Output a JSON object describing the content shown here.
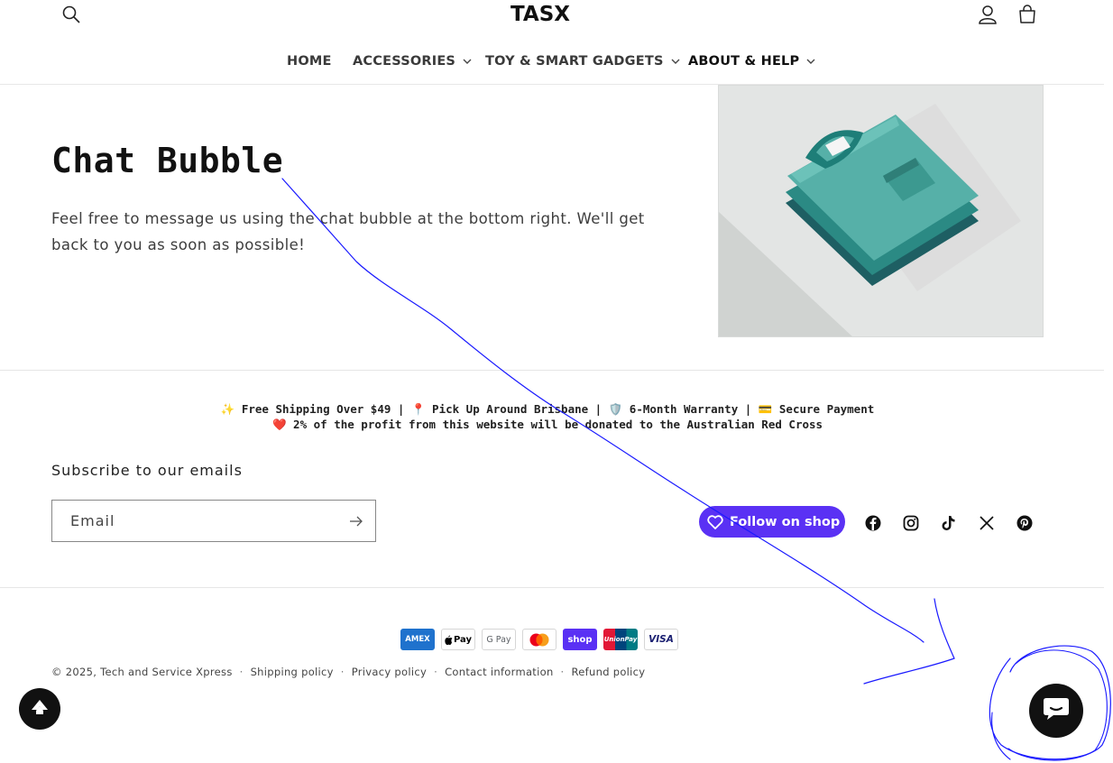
{
  "header": {
    "logo_text": "TASX",
    "search_icon": "search-icon",
    "account_icon": "account-icon",
    "cart_icon": "cart-icon"
  },
  "nav": {
    "items": [
      {
        "label": "HOME",
        "has_dropdown": false
      },
      {
        "label": "ACCESSORIES",
        "has_dropdown": true
      },
      {
        "label": "TOY & SMART GADGETS",
        "has_dropdown": true
      },
      {
        "label": "ABOUT & HELP",
        "has_dropdown": true,
        "active": true
      }
    ]
  },
  "hero": {
    "title": "Chat Bubble",
    "text": "Feel free to message us using the chat bubble at the bottom right. We'll get back to you as soon as possible!",
    "image_icon": "folded-shirts-illustration"
  },
  "announcement": {
    "line1": "✨ Free Shipping Over $49 | 📍 Pick Up Around Brisbane | 🛡️ 6-Month Warranty | 💳 Secure Payment",
    "line2": "❤️ 2% of the profit from this website will be donated to the Australian Red Cross"
  },
  "subscribe": {
    "title": "Subscribe to our emails",
    "email_placeholder": "Email"
  },
  "follow": {
    "label": "Follow on shop"
  },
  "social": [
    "facebook-icon",
    "instagram-icon",
    "tiktok-icon",
    "x-icon",
    "pinterest-icon"
  ],
  "payments": [
    {
      "name": "AMEX",
      "bg": "#1f72cd",
      "fg": "#ffffff"
    },
    {
      "name": "Pay",
      "bg": "#ffffff",
      "fg": "#000000"
    },
    {
      "name": "G Pay",
      "bg": "#ffffff",
      "fg": "#5f6368"
    },
    {
      "name": "mastercard",
      "bg": "#ffffff",
      "fg": "#000000"
    },
    {
      "name": "shop",
      "bg": "#5a31f4",
      "fg": "#ffffff"
    },
    {
      "name": "UnionPay",
      "bg": "#ffffff",
      "fg": "#ffffff"
    },
    {
      "name": "VISA",
      "bg": "#ffffff",
      "fg": "#1a1f71"
    }
  ],
  "footer": {
    "copyright": "© 2025, Tech and Service Xpress",
    "links": [
      "Shipping policy",
      "Privacy policy",
      "Contact information",
      "Refund policy"
    ]
  },
  "widgets": {
    "scroll_top_icon": "scroll-to-top-icon",
    "chat_icon": "chat-bubble-icon"
  },
  "colors": {
    "accent_shop": "#5a31f4",
    "annotation_ink": "#1a1aff"
  }
}
